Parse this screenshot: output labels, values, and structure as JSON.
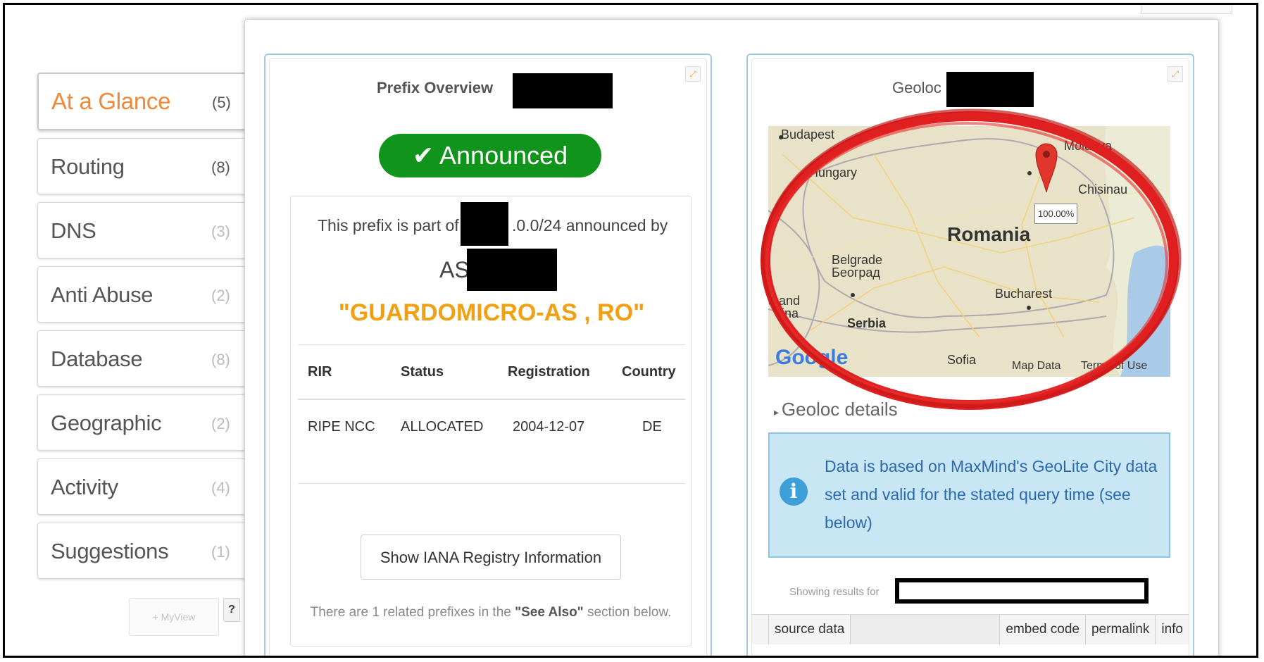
{
  "sidebar": {
    "items": [
      {
        "label": "At a Glance",
        "count": "(5)"
      },
      {
        "label": "Routing",
        "count": "(8)"
      },
      {
        "label": "DNS",
        "count": "(3)"
      },
      {
        "label": "Anti Abuse",
        "count": "(2)"
      },
      {
        "label": "Database",
        "count": "(8)"
      },
      {
        "label": "Geographic",
        "count": "(2)"
      },
      {
        "label": "Activity",
        "count": "(4)"
      },
      {
        "label": "Suggestions",
        "count": "(1)"
      }
    ],
    "myview_label": "+ MyView",
    "help_label": "?"
  },
  "prefix_widget": {
    "title": "Prefix Overview",
    "status": "✔ Announced",
    "part_prefix": "This prefix is part of",
    "part_suffix": ".0.0/24 announced by",
    "as_prefix": "AS",
    "as_name": "\"GUARDOMICRO-AS , RO\"",
    "table": {
      "headers": [
        "RIR",
        "Status",
        "Registration",
        "Country"
      ],
      "rows": [
        [
          "RIPE NCC",
          "ALLOCATED",
          "2004-12-07",
          "DE"
        ]
      ]
    },
    "iana_button": "Show IANA Registry Information",
    "related_1": "There are 1 related prefixes in the ",
    "related_bold": "\"See Also\"",
    "related_2": " section below."
  },
  "geoloc_widget": {
    "title": "Geoloc",
    "map": {
      "labels": [
        "Budapest",
        "Hungary",
        "Moldova",
        "Chisinau",
        "Romania",
        "Belgrade",
        "Београд",
        "Bucharest",
        "a and",
        "vina",
        "Serbia",
        "Sofia",
        "Map Data",
        "Terms of Use"
      ],
      "marker_percent": "100.00%",
      "logo": "Google"
    },
    "details_label": "Geoloc details",
    "info_text": "Data is based on MaxMind's GeoLite City data set and valid for the stated query time (see below)",
    "showing_label": "Showing results for",
    "bottom_bar": [
      "source data",
      "embed code",
      "permalink",
      "info"
    ]
  },
  "colors": {
    "accent_orange": "#f0883a",
    "announced_green": "#10941c",
    "as_name_orange": "#f0a010",
    "widget_border": "#9ecae4",
    "highlight_red": "#e02020"
  }
}
